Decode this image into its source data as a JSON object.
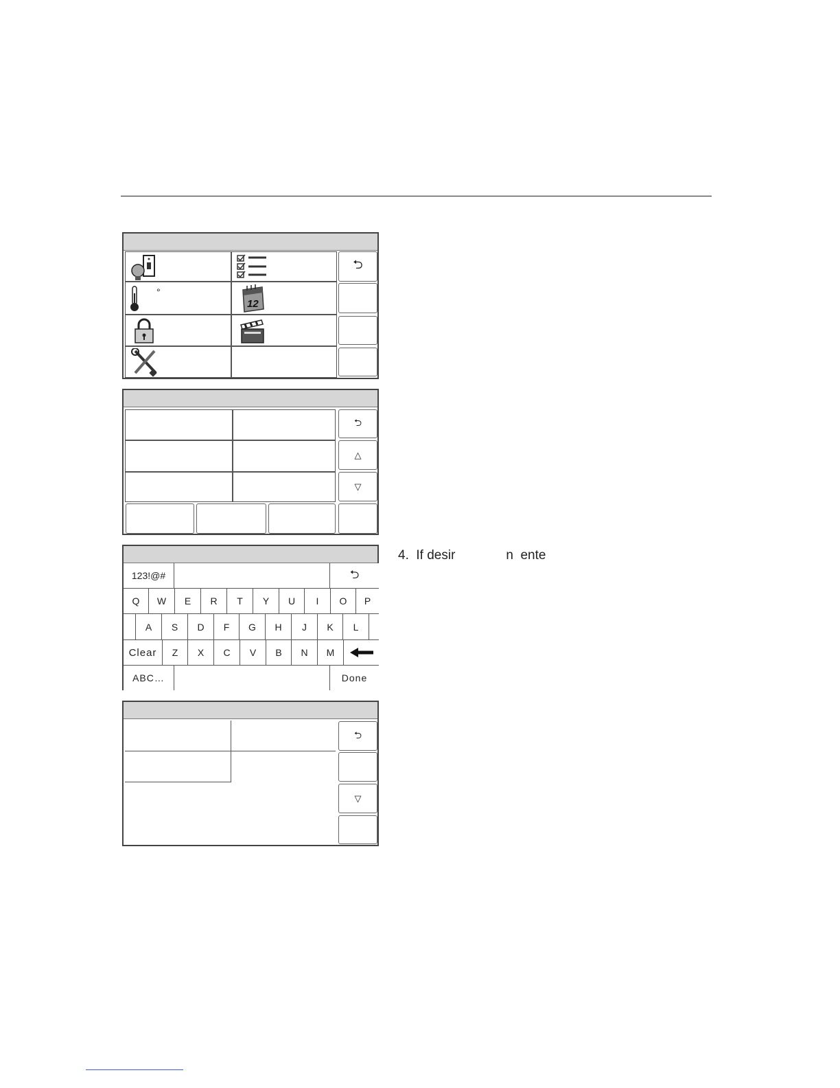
{
  "step_text": "4.  If desir              n  ente",
  "screen1": {
    "back_symbol": "⮌",
    "menu_items": [
      {
        "icon": "light-switch-icon"
      },
      {
        "icon": "checklist-icon"
      },
      {
        "icon": "thermometer-icon",
        "degree": "°"
      },
      {
        "icon": "calendar-icon",
        "calendar_day": "12"
      },
      {
        "icon": "padlock-icon"
      },
      {
        "icon": "scene-clapperboard-icon"
      },
      {
        "icon": "tools-icon"
      }
    ]
  },
  "screen2": {
    "back_symbol": "⮌",
    "up_symbol": "△",
    "down_symbol": "▽"
  },
  "keyboard": {
    "symbols_label": "123!@#",
    "back_symbol": "⮌",
    "row1": [
      "Q",
      "W",
      "E",
      "R",
      "T",
      "Y",
      "U",
      "I",
      "O",
      "P"
    ],
    "row2": [
      "A",
      "S",
      "D",
      "F",
      "G",
      "H",
      "J",
      "K",
      "L"
    ],
    "clear_label": "Clear",
    "row3": [
      "Z",
      "X",
      "C",
      "V",
      "B",
      "N",
      "M"
    ],
    "backspace_icon": "left-arrow-icon",
    "abc_label": "ABC…",
    "done_label": "Done"
  },
  "screen4": {
    "back_symbol": "⮌",
    "down_symbol": "▽"
  }
}
